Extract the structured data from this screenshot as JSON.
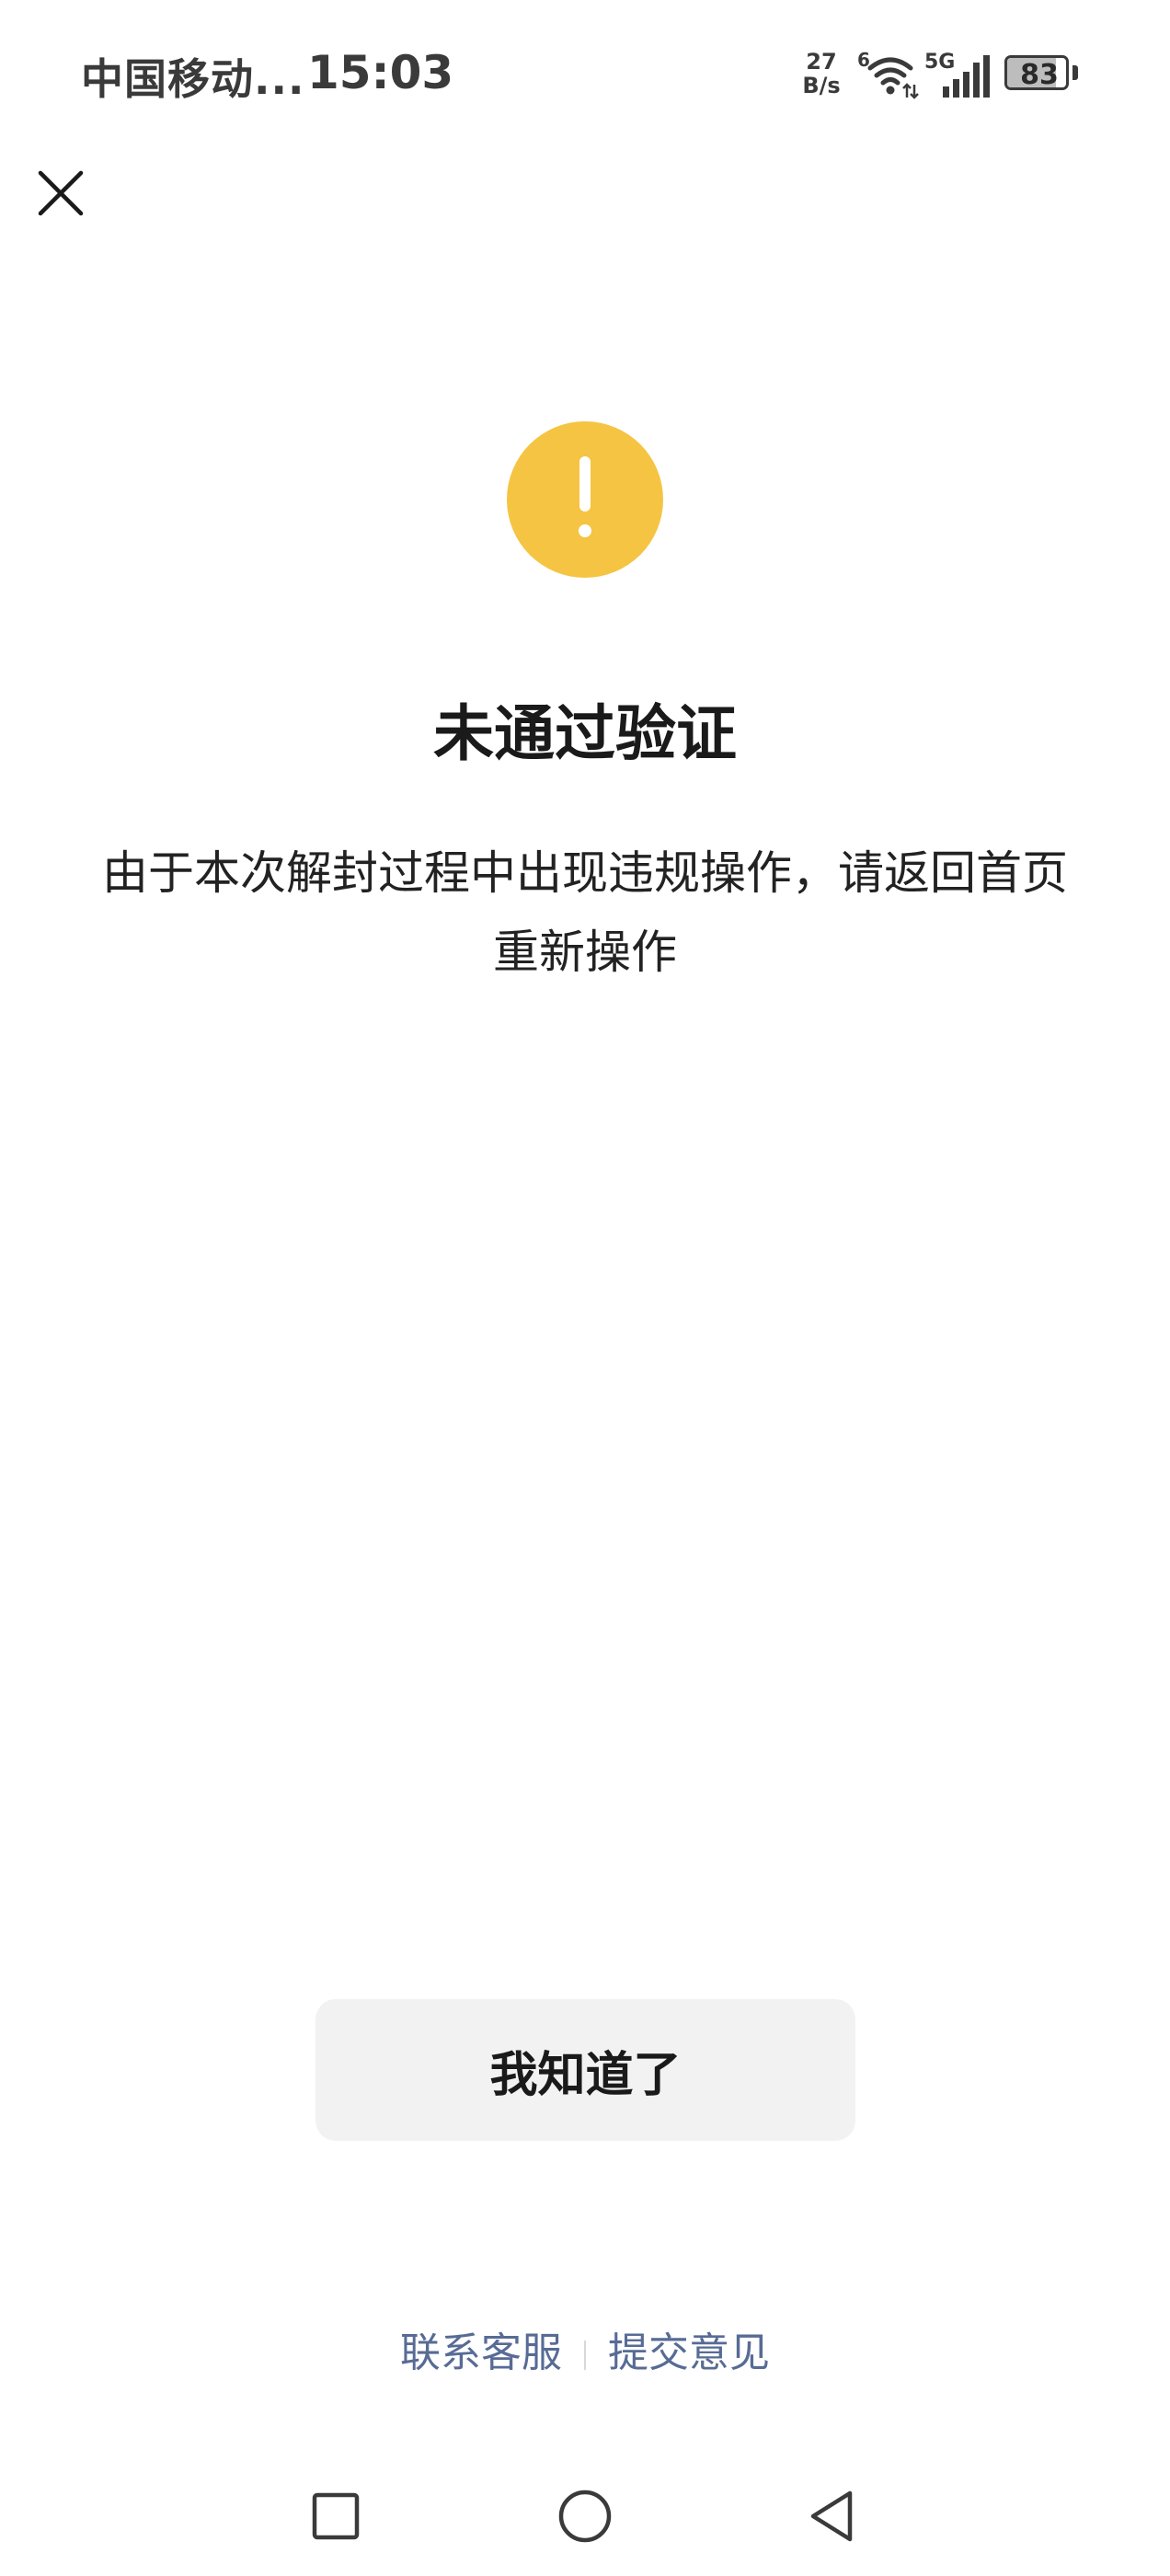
{
  "status_bar": {
    "carrier": "中国移动...",
    "time": "15:03",
    "net_speed_value": "27",
    "net_speed_unit": "B/s",
    "wifi_label": "6",
    "signal_label": "5G",
    "battery_level": "83",
    "battery_fraction": 0.83
  },
  "icons": {
    "close": "close-icon",
    "warning": "warning-icon",
    "nav_recent": "square-icon",
    "nav_home": "circle-icon",
    "nav_back": "triangle-back-icon"
  },
  "colors": {
    "warning": "#f5c442",
    "link": "#576b95",
    "button_bg": "#f2f2f2"
  },
  "main": {
    "title": "未通过验证",
    "description": "由于本次解封过程中出现违规操作，请返回首页重新操作"
  },
  "actions": {
    "ok_label": "我知道了"
  },
  "footer": {
    "contact_label": "联系客服",
    "feedback_label": "提交意见"
  }
}
